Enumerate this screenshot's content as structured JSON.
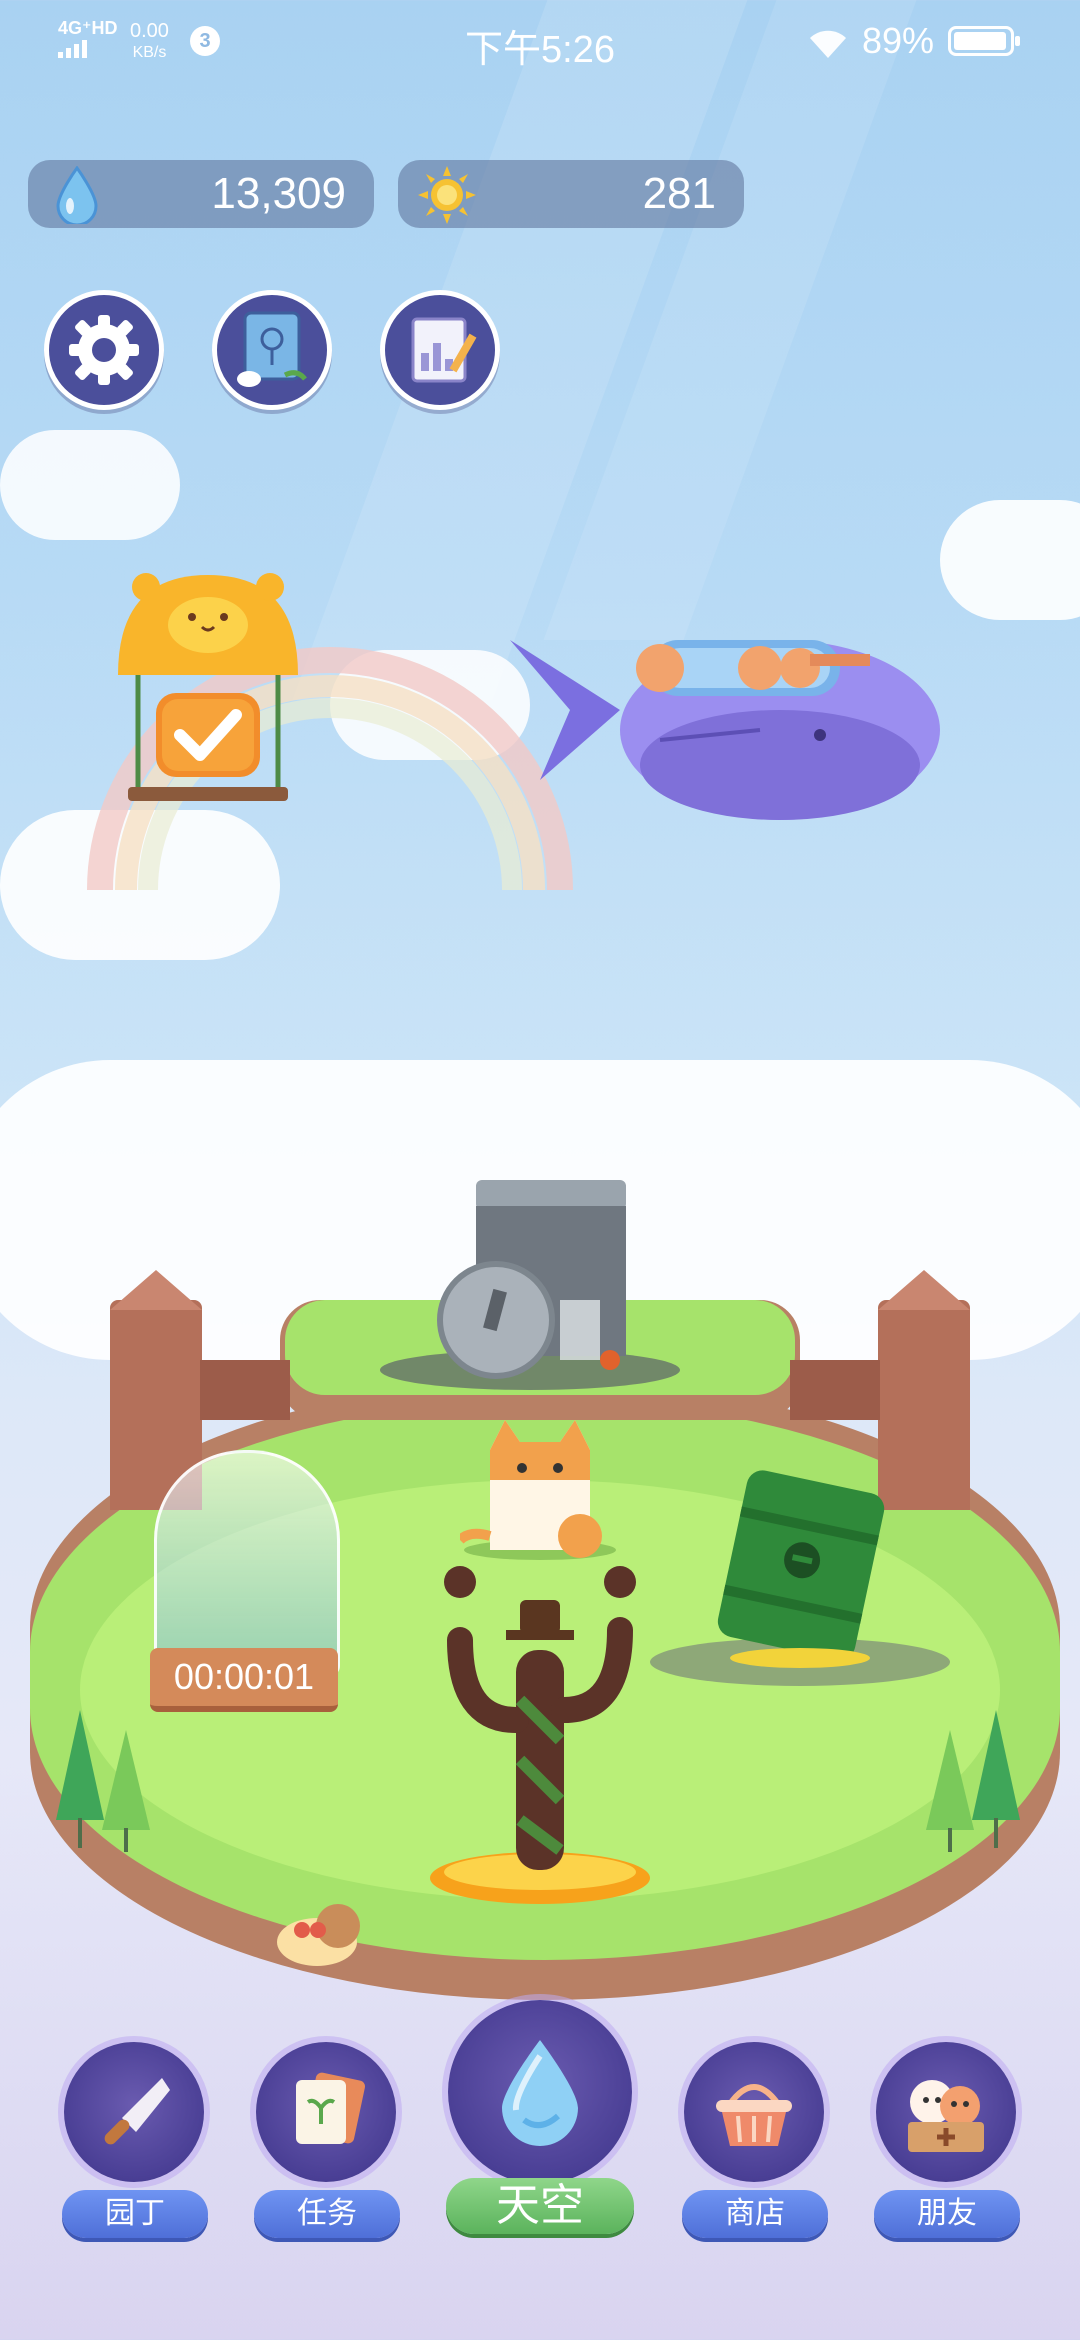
{
  "status_bar": {
    "network": "4G⁺HD",
    "speed_value": "0.00",
    "speed_unit": "KB/s",
    "notification_count": "3",
    "time": "下午5:26",
    "battery": "89%"
  },
  "resources": {
    "water": "13,309",
    "sun": "281"
  },
  "top_buttons": [
    {
      "icon": "gear-icon"
    },
    {
      "icon": "plant-book-icon"
    },
    {
      "icon": "report-icon"
    }
  ],
  "timer": "00:00:01",
  "nav": {
    "gardener": "园丁",
    "tasks": "任务",
    "sky": "天空",
    "shop": "商店",
    "friends": "朋友"
  },
  "colors": {
    "sky_top": "#a9d2f2",
    "grass": "#a6e36b",
    "nav_purple": "#4a3f95",
    "nav_blue": "#5b7fe3",
    "nav_green": "#6cc46c"
  }
}
